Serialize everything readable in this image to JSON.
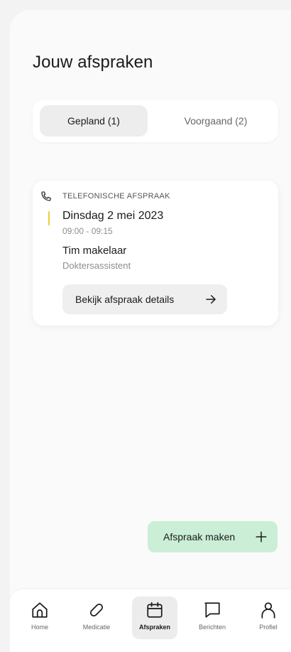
{
  "page": {
    "title": "Jouw afspraken"
  },
  "tabs": [
    {
      "label": "Gepland (1)",
      "active": true
    },
    {
      "label": "Voorgaand (2)",
      "active": false
    }
  ],
  "appointment": {
    "type": "TELEFONISCHE AFSPRAAK",
    "type_icon": "phone-icon",
    "date": "Dinsdag 2 mei 2023",
    "time": "09:00 - 09:15",
    "person": "Tim makelaar",
    "role": "Doktersassistent",
    "accent_color": "#f2c935",
    "details_button": "Bekijk afspraak details"
  },
  "actions": {
    "make_appointment": "Afspraak maken"
  },
  "nav": [
    {
      "label": "Home",
      "icon": "home-icon"
    },
    {
      "label": "Medicatie",
      "icon": "pill-icon"
    },
    {
      "label": "Afspraken",
      "icon": "calendar-icon",
      "active": true
    },
    {
      "label": "Berichten",
      "icon": "message-icon"
    },
    {
      "label": "Profiel",
      "icon": "person-icon"
    }
  ],
  "colors": {
    "primary_action_bg": "#cbeed6",
    "active_tab_bg": "#ededed"
  }
}
